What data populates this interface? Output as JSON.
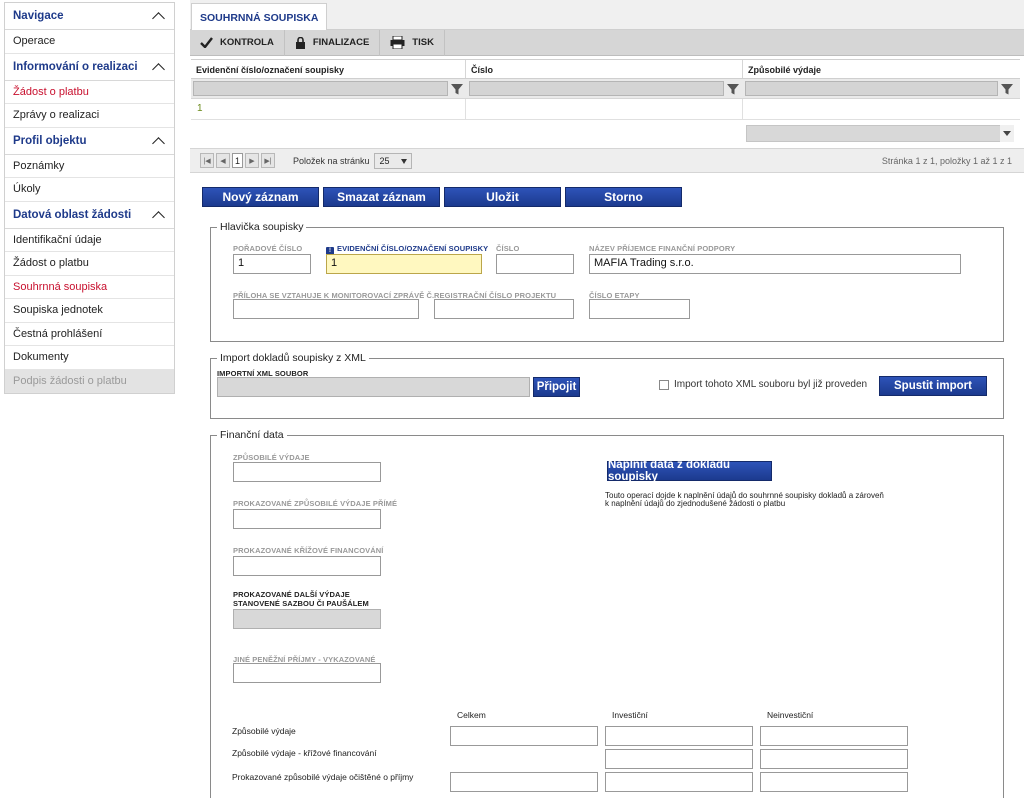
{
  "sidebar": {
    "sections": [
      {
        "title": "Navigace",
        "items": [
          {
            "label": "Operace",
            "state": "normal"
          }
        ]
      },
      {
        "title": "Informování o realizaci",
        "items": [
          {
            "label": "Žádost o platbu",
            "state": "red"
          },
          {
            "label": "Zprávy o realizaci",
            "state": "normal"
          }
        ]
      },
      {
        "title": "Profil objektu",
        "items": [
          {
            "label": "Poznámky",
            "state": "normal"
          },
          {
            "label": "Úkoly",
            "state": "normal"
          }
        ]
      },
      {
        "title": "Datová oblast žádosti",
        "items": [
          {
            "label": "Identifikační údaje",
            "state": "normal"
          },
          {
            "label": "Žádost o platbu",
            "state": "normal"
          },
          {
            "label": "Souhrnná soupiska",
            "state": "red"
          },
          {
            "label": "Soupiska jednotek",
            "state": "normal"
          },
          {
            "label": "Čestná prohlášení",
            "state": "normal"
          },
          {
            "label": "Dokumenty",
            "state": "normal"
          },
          {
            "label": "Podpis žádosti o platbu",
            "state": "disabled"
          }
        ]
      }
    ]
  },
  "tab": {
    "label": "SOUHRNNÁ SOUPISKA"
  },
  "toolbar": {
    "kontrola": "KONTROLA",
    "finalizace": "FINALIZACE",
    "tisk": "TISK"
  },
  "grid": {
    "headers": [
      "Evidenční číslo/označení soupisky",
      "Číslo",
      "Způsobilé výdaje"
    ],
    "rows": [
      {
        "evidencni": "1",
        "cislo": "",
        "vydaje": ""
      }
    ]
  },
  "pager": {
    "current_page": "1",
    "page_size_label": "Položek na stránku",
    "page_size": "25",
    "info": "Stránka 1 z 1, položky 1 až 1 z 1"
  },
  "actions": {
    "new": "Nový záznam",
    "delete": "Smazat záznam",
    "save": "Uložit",
    "cancel": "Storno"
  },
  "header_section": {
    "legend": "Hlavička soupisky",
    "poradove_label": "POŘADOVÉ ČÍSLO",
    "poradove_value": "1",
    "evidencni_label": "EVIDENČNÍ ČÍSLO/OZNAČENÍ SOUPISKY",
    "evidencni_value": "1",
    "cislo_label": "ČÍSLO",
    "cislo_value": "",
    "prijemce_label": "NÁZEV PŘÍJEMCE FINANČNÍ PODPORY",
    "prijemce_value": "MAFIA Trading s.r.o.",
    "priloha_label": "PŘÍLOHA SE VZTAHUJE K MONITOROVACÍ ZPRÁVĚ Č.",
    "registracni_label": "REGISTRAČNÍ ČÍSLO PROJEKTU",
    "etapa_label": "ČÍSLO ETAPY"
  },
  "import_section": {
    "legend": "Import dokladů soupisky z XML",
    "file_label": "IMPORTNÍ XML SOUBOR",
    "attach": "Připojit",
    "checkbox_label": "Import tohoto XML souboru byl již proveden",
    "run": "Spustit import"
  },
  "finance_section": {
    "legend": "Finanční data",
    "zpusobile_label": "ZPŮSOBILÉ VÝDAJE",
    "prime_label": "PROKAZOVANÉ ZPŮSOBILÉ VÝDAJE PŘÍMÉ",
    "krizove_label": "PROKAZOVANÉ KŘÍŽOVÉ FINANCOVÁNÍ",
    "dalsi_label": "PROKAZOVANÉ DALŠÍ VÝDAJE STANOVENÉ SAZBOU ČI PAUŠÁLEM",
    "jine_label": "JINÉ PENĚŽNÍ PŘÍJMY - VYKAZOVANÉ",
    "fill_button": "Naplnit data z dokladů soupisky",
    "fill_note_1": "Touto operací dojde k naplnění údajů do souhrnné soupisky dokladů a zároveň",
    "fill_note_2": "k naplnění údajů do zjednodušené žádosti o platbu",
    "col_total": "Celkem",
    "col_invest": "Investiční",
    "col_noninvest": "Neinvestiční",
    "row_1": "Způsobilé výdaje",
    "row_2": "Způsobilé výdaje - křížové financování",
    "row_3": "Prokazované způsobilé výdaje očištěné o příjmy"
  }
}
